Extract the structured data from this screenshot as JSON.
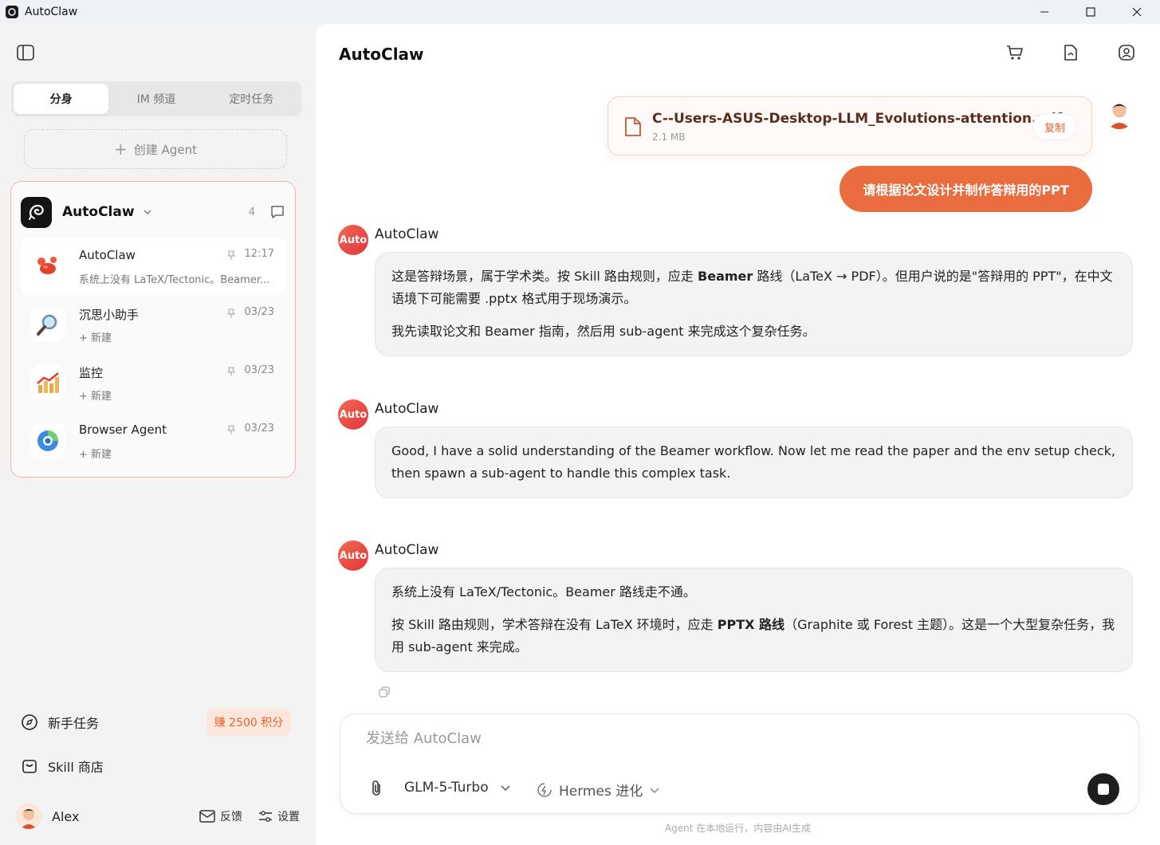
{
  "window": {
    "title": "AutoClaw"
  },
  "sidebar": {
    "tabs": [
      {
        "label": "分身",
        "active": true
      },
      {
        "label": "IM 频道",
        "active": false
      },
      {
        "label": "定时任务",
        "active": false
      }
    ],
    "create_agent": "创建 Agent",
    "agent": {
      "name": "AutoClaw",
      "count": "4",
      "sessions": [
        {
          "title": "AutoClaw",
          "subtitle": "系统上没有 LaTeX/Tectonic。Beamer...",
          "time": "12:17",
          "icon": "lobster-icon"
        },
        {
          "title": "沉思小助手",
          "subtitle": "+ 新建",
          "time": "03/23",
          "icon": "magnifier-icon"
        },
        {
          "title": "监控",
          "subtitle": "+ 新建",
          "time": "03/23",
          "icon": "chart-icon"
        },
        {
          "title": "Browser Agent",
          "subtitle": "+ 新建",
          "time": "03/23",
          "icon": "browser-icon"
        }
      ]
    },
    "beginner_tasks": "新手任务",
    "earn_badge": "赚 2500 积分",
    "skill_store": "Skill 商店",
    "user": {
      "name": "Alex",
      "feedback": "反馈",
      "settings": "设置"
    }
  },
  "main": {
    "title": "AutoClaw",
    "file": {
      "name": "C--Users-ASUS-Desktop-LLM_Evolutions-attention.pdf",
      "size": "2.1 MB",
      "copy_label": "复制"
    },
    "user_message": "请根据论文设计并制作答辩用的PPT",
    "messages": [
      {
        "sender": "AutoClaw",
        "avatar_text": "Auto",
        "paragraphs": [
          {
            "pre": "这是答辩场景，属于学术类。按 Skill 路由规则，应走 ",
            "bold": "Beamer",
            "post": " 路线（LaTeX → PDF）。但用户说的是\"答辩用的 PPT\"，在中文语境下可能需要 .pptx 格式用于现场演示。"
          },
          {
            "pre": "我先读取论文和 Beamer 指南，然后用 sub-agent 来完成这个复杂任务。",
            "bold": "",
            "post": ""
          }
        ]
      },
      {
        "sender": "AutoClaw",
        "avatar_text": "Auto",
        "paragraphs": [
          {
            "pre": "Good, I have a solid understanding of the Beamer workflow. Now let me read the paper and the env setup check, then spawn a sub-agent to handle this complex task.",
            "bold": "",
            "post": ""
          }
        ]
      },
      {
        "sender": "AutoClaw",
        "avatar_text": "Auto",
        "paragraphs": [
          {
            "pre": "系统上没有 LaTeX/Tectonic。Beamer 路线走不通。",
            "bold": "",
            "post": ""
          },
          {
            "pre": "按 Skill 路由规则，学术答辩在没有 LaTeX 环境时，应走 ",
            "bold": "PPTX 路线",
            "post": "（Graphite 或 Forest 主题）。这是一个大型复杂任务，我用 sub-agent 来完成。"
          }
        ]
      }
    ],
    "composer": {
      "placeholder": "发送给 AutoClaw",
      "model": "GLM-5-Turbo",
      "mode": "Hermes 进化"
    },
    "footer": "Agent 在本地运行，内容由AI生成"
  },
  "colors": {
    "accent": "#ea6d40",
    "accent_soft": "#fde7dc",
    "sidebar_bg": "#f3f3f4"
  }
}
